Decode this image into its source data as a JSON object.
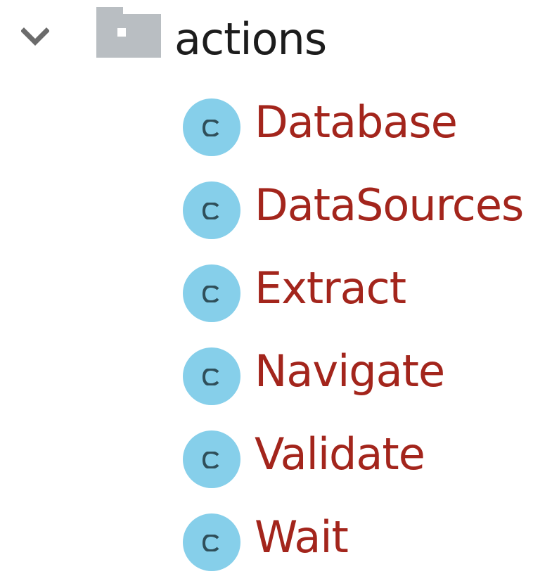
{
  "tree": {
    "folder": {
      "label": "actions",
      "expanded": true,
      "chevron_icon": "chevron-down-icon",
      "folder_icon": "folder-icon",
      "folder_color": "#b9bec2",
      "label_color": "#1c1c1c"
    },
    "class_icon": "class-c-icon",
    "class_icon_color": "#86cfea",
    "class_label_color": "#a3251c",
    "items": [
      {
        "label": "Database"
      },
      {
        "label": "DataSources"
      },
      {
        "label": "Extract"
      },
      {
        "label": "Navigate"
      },
      {
        "label": "Validate"
      },
      {
        "label": "Wait"
      }
    ]
  }
}
